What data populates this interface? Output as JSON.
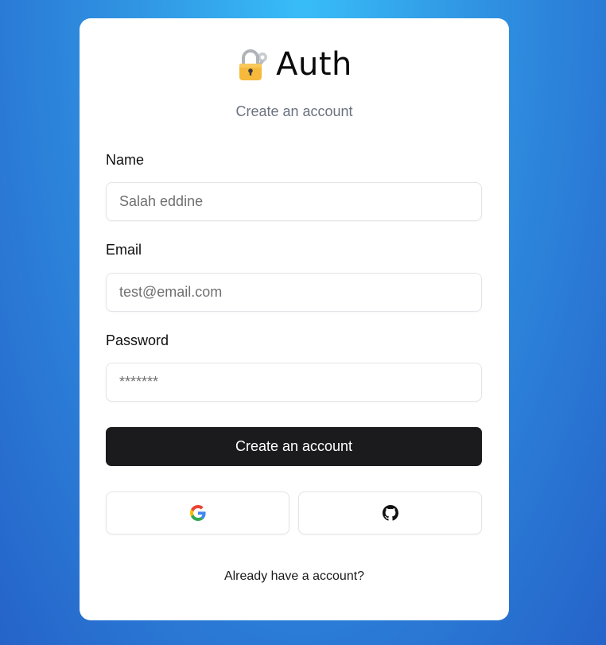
{
  "app": {
    "title": "Auth",
    "logo_icon": "lock-with-key-icon"
  },
  "form": {
    "subtitle": "Create an account",
    "name": {
      "label": "Name",
      "value": "",
      "placeholder": "Salah eddine"
    },
    "email": {
      "label": "Email",
      "value": "",
      "placeholder": "test@email.com"
    },
    "password": {
      "label": "Password",
      "value": "",
      "placeholder": "*******"
    },
    "submit_label": "Create an account"
  },
  "social": {
    "google_icon": "google-icon",
    "github_icon": "github-icon"
  },
  "footer": {
    "login_link": "Already have a account?"
  },
  "colors": {
    "primary_button": "#1b1b1d",
    "background_top": "#38bdf8",
    "background_bottom": "#2563c9"
  }
}
